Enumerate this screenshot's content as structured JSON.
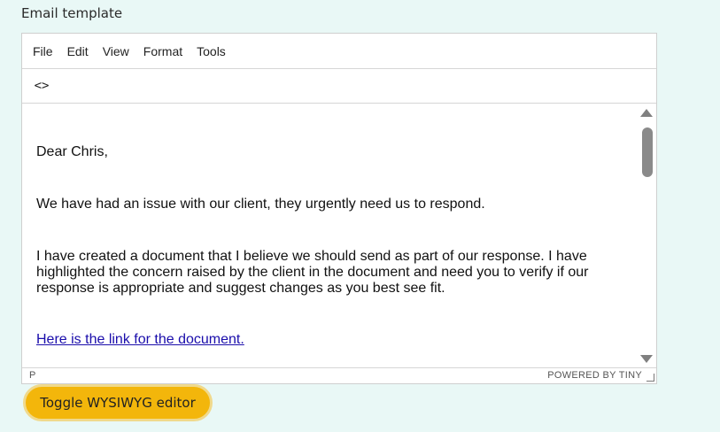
{
  "field_label": "Email template",
  "menubar": {
    "items": [
      "File",
      "Edit",
      "View",
      "Format",
      "Tools"
    ]
  },
  "toolbar": {
    "source_code_icon": "source-code-icon",
    "source_code_glyph": "<>"
  },
  "content": {
    "greeting": "Dear Chris,",
    "paragraph_1": "We have had an issue with our client, they urgently need us to respond.",
    "paragraph_2": "I have created a document that I believe we should send as part of our response. I have highlighted the concern raised by the client in the document and need you to verify if our response is appropriate and suggest changes as you best see fit.",
    "link_text": "Here is the link for the document."
  },
  "statusbar": {
    "path": "P",
    "powered_by": "POWERED BY TINY"
  },
  "toggle_button": {
    "label": "Toggle WYSIWYG editor"
  },
  "colors": {
    "page_background": "#e9f8f6",
    "button_background": "#f3b60b",
    "link": "#1a0dab"
  }
}
